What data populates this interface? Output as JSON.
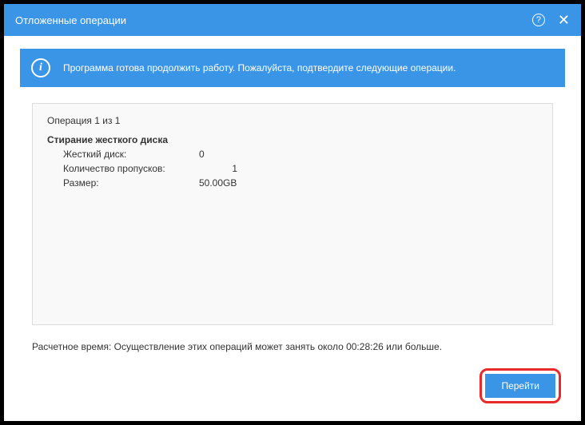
{
  "window": {
    "title": "Отложенные операции"
  },
  "infoBar": {
    "message": "Программа готова продолжить работу. Пожалуйста, подтвердите следующие операции."
  },
  "operations": {
    "counter": "Операция 1 из 1",
    "title": "Стирание жесткого диска",
    "rows": {
      "diskLabel": "Жесткий диск:",
      "diskValue": "0",
      "passesLabel": "Количество пропусков:",
      "passesValue": "1",
      "sizeLabel": "Размер:",
      "sizeValue": "50.00GB"
    }
  },
  "estimate": "Расчетное время: Осуществление этих операций может занять около 00:28:26 или больше.",
  "buttons": {
    "proceed": "Перейти"
  }
}
